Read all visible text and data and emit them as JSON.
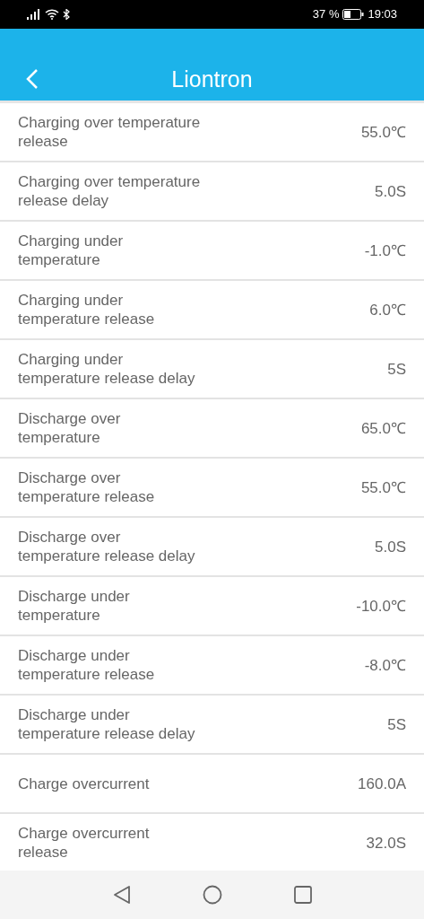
{
  "status_bar": {
    "battery": "37 %",
    "time": "19:03"
  },
  "header": {
    "title": "Liontron"
  },
  "rows": [
    {
      "label": "Charging over temperature release",
      "value": "55.0℃"
    },
    {
      "label": "Charging over temperature release delay",
      "value": "5.0S"
    },
    {
      "label": "Charging under temperature",
      "value": "-1.0℃"
    },
    {
      "label": "Charging under temperature release",
      "value": "6.0℃"
    },
    {
      "label": "Charging under temperature release delay",
      "value": "5S"
    },
    {
      "label": "Discharge over temperature",
      "value": "65.0℃"
    },
    {
      "label": "Discharge over temperature release",
      "value": "55.0℃"
    },
    {
      "label": "Discharge over temperature release delay",
      "value": "5.0S"
    },
    {
      "label": "Discharge under temperature",
      "value": "-10.0℃"
    },
    {
      "label": "Discharge under temperature release",
      "value": "-8.0℃"
    },
    {
      "label": "Discharge under temperature release delay",
      "value": "5S"
    },
    {
      "label": "Charge overcurrent",
      "value": "160.0A"
    },
    {
      "label": "Charge overcurrent release",
      "value": "32.0S"
    }
  ]
}
